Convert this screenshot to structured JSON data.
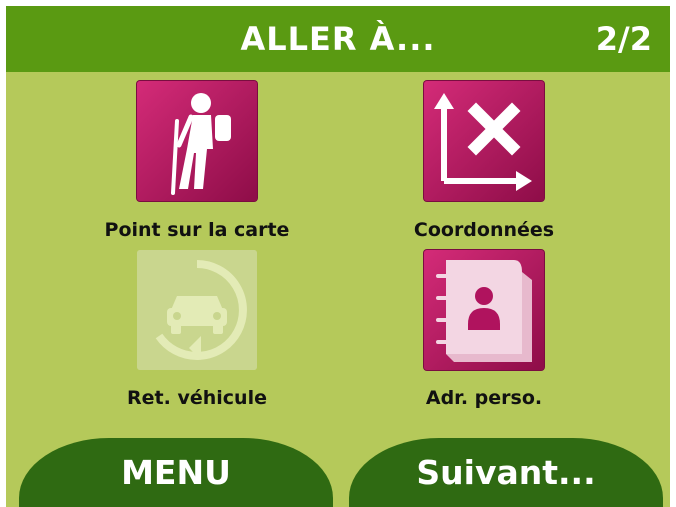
{
  "header": {
    "title": "ALLER À...",
    "page": "2/2"
  },
  "items": [
    {
      "label": "Point sur la carte",
      "icon": "hiker-icon",
      "state": "active"
    },
    {
      "label": "Coordonnées",
      "icon": "coordinates-icon",
      "state": "active"
    },
    {
      "label": "Ret. véhicule",
      "icon": "car-return-icon",
      "state": "disabled"
    },
    {
      "label": "Adr. perso.",
      "icon": "contact-card-icon",
      "state": "active"
    }
  ],
  "footer": {
    "menu_label": "MENU",
    "next_label": "Suivant..."
  },
  "colors": {
    "background": "#b5c95a",
    "header": "#5a9a12",
    "tile_active": "#b0135e",
    "tile_disabled": "#c7d58a",
    "button": "#2f6a12"
  }
}
